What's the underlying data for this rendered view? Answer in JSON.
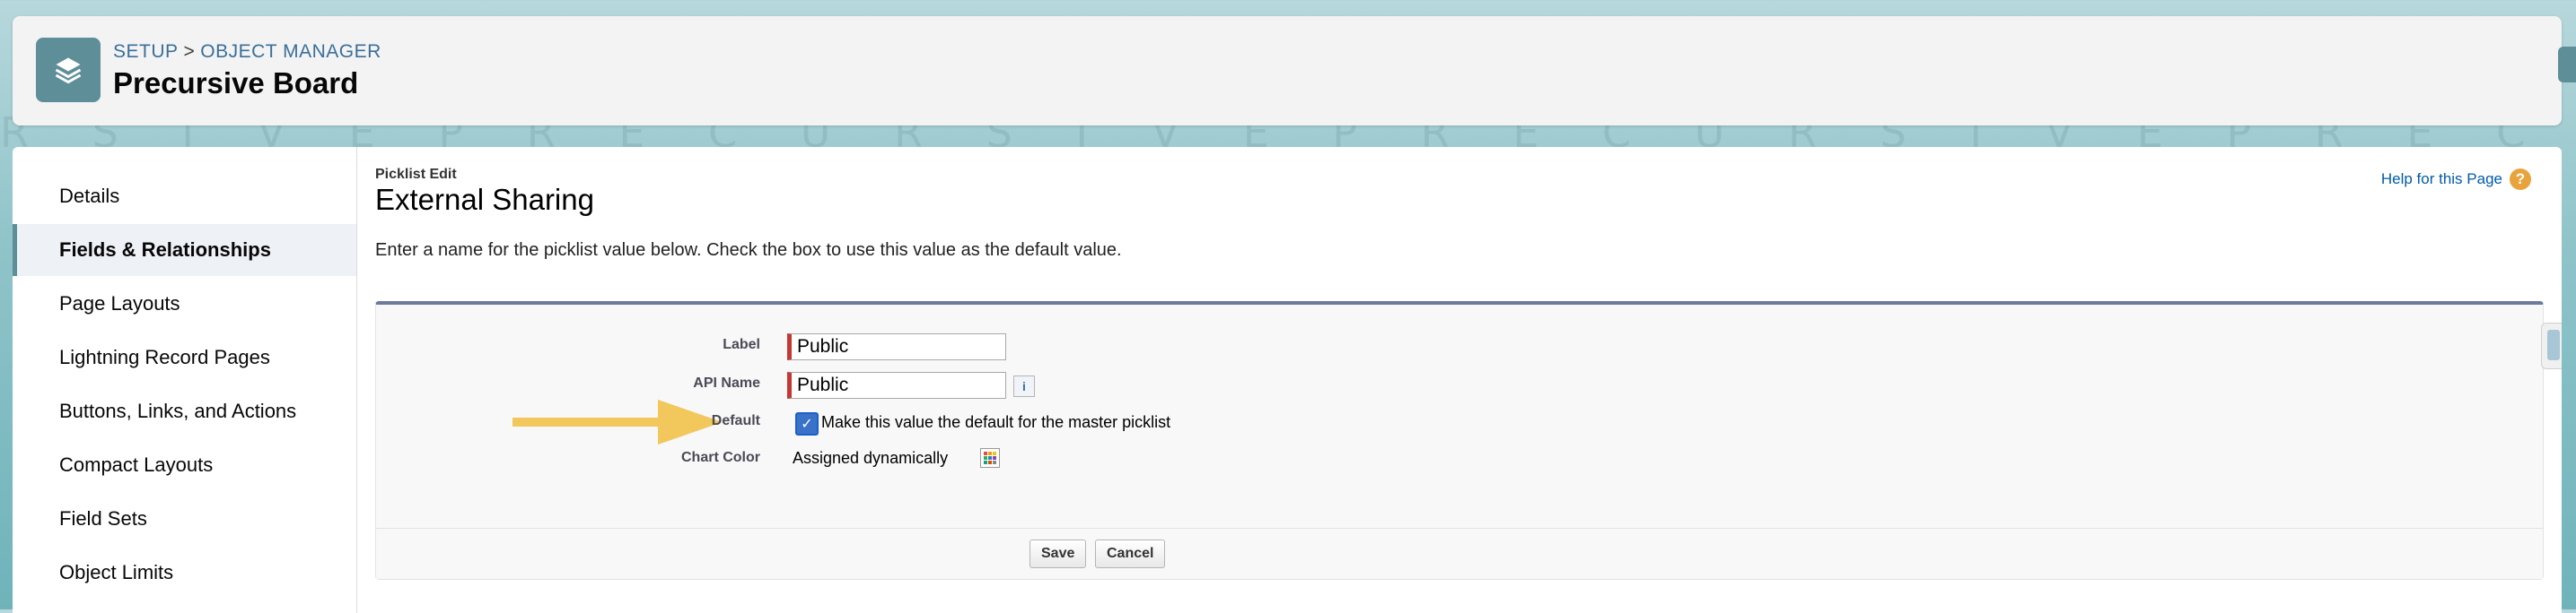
{
  "header": {
    "breadcrumb_setup": "SETUP",
    "breadcrumb_sep": ">",
    "breadcrumb_object_manager": "OBJECT MANAGER",
    "title": "Precursive Board",
    "icon": "layers-icon"
  },
  "sidebar": {
    "items": [
      {
        "label": "Details",
        "active": false
      },
      {
        "label": "Fields & Relationships",
        "active": true
      },
      {
        "label": "Page Layouts",
        "active": false
      },
      {
        "label": "Lightning Record Pages",
        "active": false
      },
      {
        "label": "Buttons, Links, and Actions",
        "active": false
      },
      {
        "label": "Compact Layouts",
        "active": false
      },
      {
        "label": "Field Sets",
        "active": false
      },
      {
        "label": "Object Limits",
        "active": false
      }
    ]
  },
  "main": {
    "subhead": "Picklist Edit",
    "title": "External Sharing",
    "help_link": "Help for this Page",
    "instructions": "Enter a name for the picklist value below. Check the box to use this value as the default value.",
    "form": {
      "label_label": "Label",
      "label_value": "Public",
      "api_name_label": "API Name",
      "api_name_value": "Public",
      "default_label": "Default",
      "default_checked": true,
      "default_text": "Make this value the default for the master picklist",
      "chart_color_label": "Chart Color",
      "chart_color_value": "Assigned dynamically"
    },
    "buttons": {
      "save": "Save",
      "cancel": "Cancel"
    }
  },
  "colors": {
    "brand": "#5e8f99",
    "required_bar": "#c23934",
    "arrow": "#f2c75c",
    "link": "#015ba7"
  }
}
